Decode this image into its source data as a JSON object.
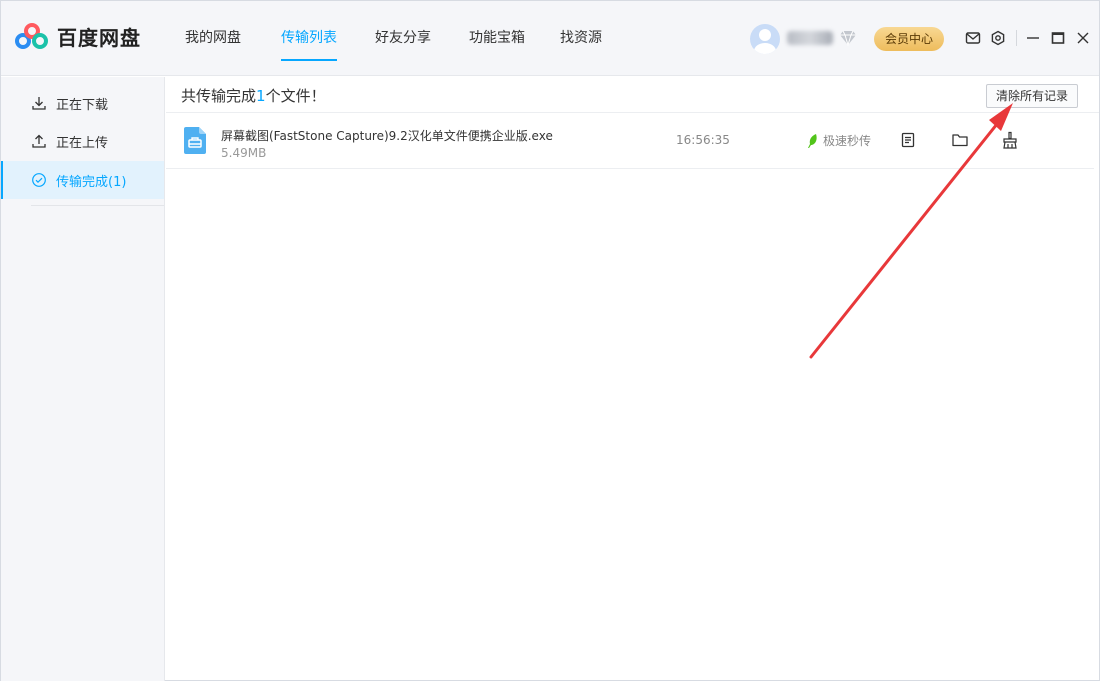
{
  "app": {
    "name": "百度网盘"
  },
  "nav": {
    "items": [
      {
        "label": "我的网盘"
      },
      {
        "label": "传输列表"
      },
      {
        "label": "好友分享"
      },
      {
        "label": "功能宝箱"
      },
      {
        "label": "找资源"
      }
    ],
    "active_index": 1
  },
  "user": {
    "vip_button": "会员中心"
  },
  "sidebar": {
    "items": [
      {
        "label": "正在下载",
        "icon": "download-icon"
      },
      {
        "label": "正在上传",
        "icon": "upload-icon"
      },
      {
        "label": "传输完成(1)",
        "icon": "check-circle-icon"
      }
    ],
    "active_index": 2
  },
  "main": {
    "summary_prefix": "共传输完成",
    "summary_count": "1",
    "summary_suffix": "个文件！",
    "clear_button": "清除所有记录",
    "files": [
      {
        "name": "屏幕截图(FastStone Capture)9.2汉化单文件便携企业版.exe",
        "size": "5.49MB",
        "time": "16:56:35",
        "status": "极速秒传"
      }
    ]
  },
  "colors": {
    "accent": "#06a7ff",
    "vip_gold": "#eebc5c",
    "annotation_arrow": "#e8383a"
  }
}
